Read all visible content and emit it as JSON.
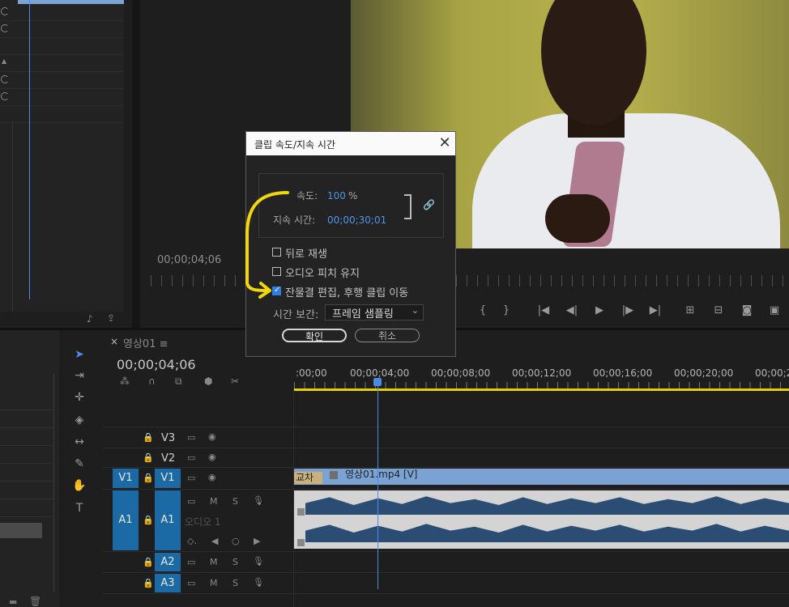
{
  "program_monitor": {
    "timecode": "00;00;04;06"
  },
  "sequence": {
    "tab_name": "영상01",
    "timecode": "00;00;04;06",
    "ruler_labels": [
      ":00;00",
      "00;00;04;00",
      "00;00;08;00",
      "00;00;12;00",
      "00;00;16;00",
      "00;00;20;00",
      "00;00;2"
    ]
  },
  "tracks": {
    "v3": "V3",
    "v2": "V2",
    "v1": "V1",
    "v1_src": "V1",
    "a1": "A1",
    "a1_src": "A1",
    "a1_name": "오디오 1",
    "a2": "A2",
    "a3": "A3",
    "m": "M",
    "s": "S"
  },
  "clips": {
    "video_label": "영상01.mp4 [V]",
    "transition_label": "교차"
  },
  "dialog": {
    "title": "클립 속도/지속 시간",
    "speed_label": "속도:",
    "speed_value": "100",
    "speed_unit": "%",
    "duration_label": "지속 시간:",
    "duration_value": "00;00;30;01",
    "reverse_label": "뒤로 재생",
    "maintain_pitch_label": "오디오 피치 유지",
    "ripple_label": "잔물결 편집, 후행 클립 이동",
    "interp_label": "시간 보간:",
    "interp_value": "프레임 샘플링",
    "ok_label": "확인",
    "cancel_label": "취소",
    "ripple_checked": true
  },
  "colors": {
    "accent_blue": "#4a8be8",
    "work_area": "#e8d100",
    "annotation": "#f2d60a",
    "clip_video": "#7aa3d4"
  }
}
